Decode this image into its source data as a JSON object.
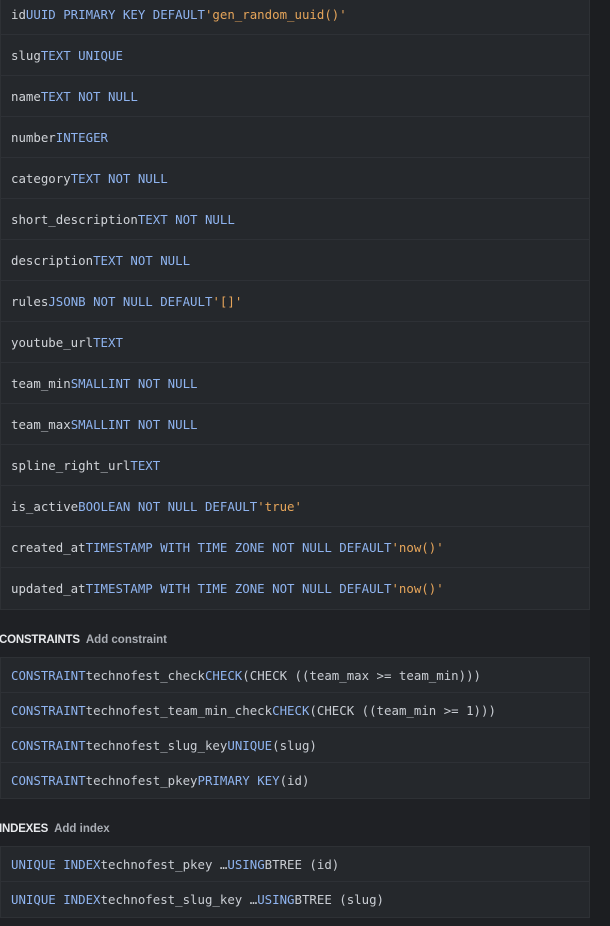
{
  "columns": [
    {
      "name": "id",
      "parts": [
        {
          "t": "UUID PRIMARY KEY DEFAULT",
          "c": "kw"
        },
        {
          "t": "'gen_random_uuid()'",
          "c": "str"
        }
      ]
    },
    {
      "name": "slug",
      "parts": [
        {
          "t": "TEXT UNIQUE",
          "c": "kw"
        }
      ]
    },
    {
      "name": "name",
      "parts": [
        {
          "t": "TEXT NOT NULL",
          "c": "kw"
        }
      ]
    },
    {
      "name": "number",
      "parts": [
        {
          "t": "INTEGER",
          "c": "kw"
        }
      ]
    },
    {
      "name": "category",
      "parts": [
        {
          "t": "TEXT NOT NULL",
          "c": "kw"
        }
      ]
    },
    {
      "name": "short_description",
      "parts": [
        {
          "t": "TEXT NOT NULL",
          "c": "kw"
        }
      ]
    },
    {
      "name": "description",
      "parts": [
        {
          "t": "TEXT NOT NULL",
          "c": "kw"
        }
      ]
    },
    {
      "name": "rules",
      "parts": [
        {
          "t": "JSONB NOT NULL DEFAULT",
          "c": "kw"
        },
        {
          "t": "'[]'",
          "c": "str"
        }
      ]
    },
    {
      "name": "youtube_url",
      "parts": [
        {
          "t": "TEXT",
          "c": "kw"
        }
      ]
    },
    {
      "name": "team_min",
      "parts": [
        {
          "t": "SMALLINT NOT NULL",
          "c": "kw"
        }
      ]
    },
    {
      "name": "team_max",
      "parts": [
        {
          "t": "SMALLINT NOT NULL",
          "c": "kw"
        }
      ]
    },
    {
      "name": "spline_right_url",
      "parts": [
        {
          "t": "TEXT",
          "c": "kw"
        }
      ]
    },
    {
      "name": "is_active",
      "parts": [
        {
          "t": "BOOLEAN NOT NULL DEFAULT",
          "c": "kw"
        },
        {
          "t": "'true'",
          "c": "str"
        }
      ]
    },
    {
      "name": "created_at",
      "parts": [
        {
          "t": "TIMESTAMP WITH TIME ZONE NOT NULL DEFAULT",
          "c": "kw"
        },
        {
          "t": "'now()'",
          "c": "str"
        }
      ]
    },
    {
      "name": "updated_at",
      "parts": [
        {
          "t": "TIMESTAMP WITH TIME ZONE NOT NULL DEFAULT",
          "c": "kw"
        },
        {
          "t": "'now()'",
          "c": "str"
        }
      ]
    }
  ],
  "constraints_section": {
    "title": "CONSTRAINTS",
    "action": "Add constraint"
  },
  "constraints": [
    [
      {
        "t": "CONSTRAINT",
        "c": "kw"
      },
      {
        "t": "technofest_check",
        "c": "plain"
      },
      {
        "t": "CHECK",
        "c": "kw"
      },
      {
        "t": "(CHECK ((team_max >= team_min)))",
        "c": "plain"
      }
    ],
    [
      {
        "t": "CONSTRAINT",
        "c": "kw"
      },
      {
        "t": "technofest_team_min_check",
        "c": "plain"
      },
      {
        "t": "CHECK",
        "c": "kw"
      },
      {
        "t": "(CHECK ((team_min >= 1)))",
        "c": "plain"
      }
    ],
    [
      {
        "t": "CONSTRAINT",
        "c": "kw"
      },
      {
        "t": "technofest_slug_key",
        "c": "plain"
      },
      {
        "t": "UNIQUE",
        "c": "kw"
      },
      {
        "t": "(slug)",
        "c": "plain"
      }
    ],
    [
      {
        "t": "CONSTRAINT",
        "c": "kw"
      },
      {
        "t": "technofest_pkey",
        "c": "plain"
      },
      {
        "t": "PRIMARY KEY",
        "c": "kw"
      },
      {
        "t": "(id)",
        "c": "plain"
      }
    ]
  ],
  "indexes_section": {
    "title": "INDEXES",
    "action": "Add index"
  },
  "indexes": [
    [
      {
        "t": "UNIQUE INDEX",
        "c": "kw"
      },
      {
        "t": "technofest_pkey …",
        "c": "plain"
      },
      {
        "t": "USING",
        "c": "kw"
      },
      {
        "t": "BTREE (id)",
        "c": "plain"
      }
    ],
    [
      {
        "t": "UNIQUE INDEX",
        "c": "kw"
      },
      {
        "t": "technofest_slug_key …",
        "c": "plain"
      },
      {
        "t": "USING",
        "c": "kw"
      },
      {
        "t": "BTREE (slug)",
        "c": "plain"
      }
    ]
  ]
}
